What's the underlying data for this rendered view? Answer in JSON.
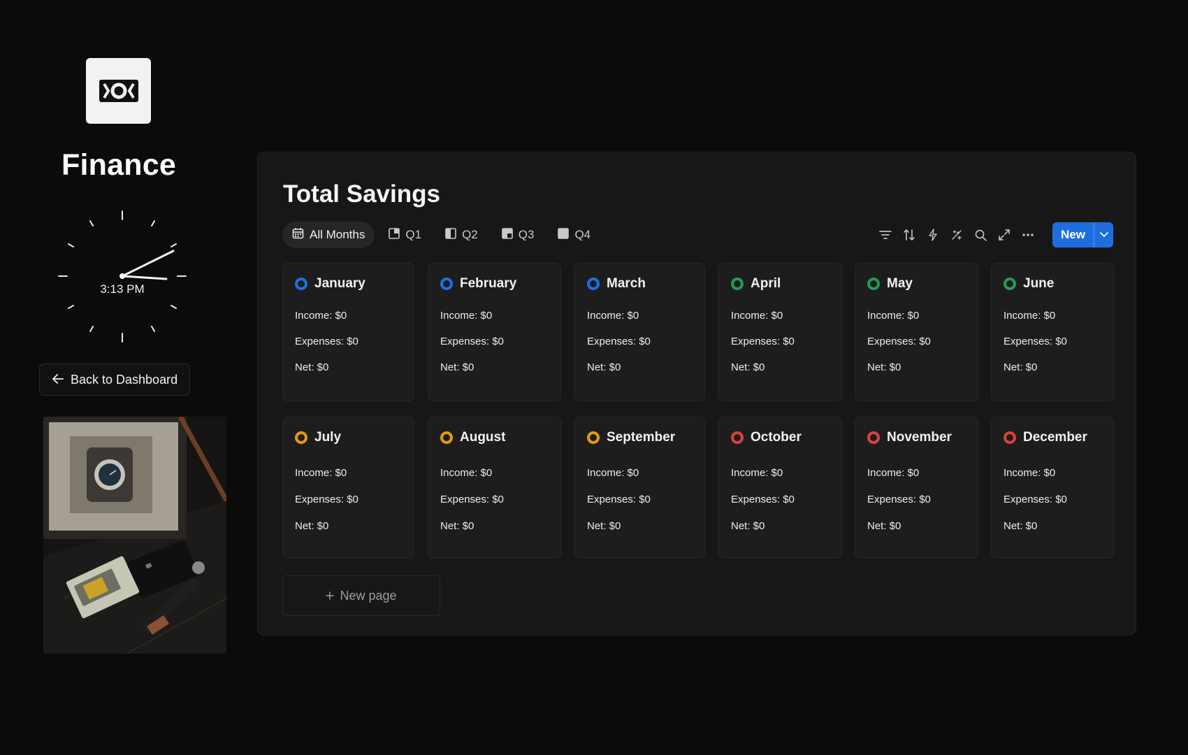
{
  "app": {
    "title": "Finance"
  },
  "clock": {
    "time": "3:13 PM"
  },
  "sidebar": {
    "back_label": "Back to Dashboard"
  },
  "panel": {
    "title": "Total Savings",
    "tabs": [
      {
        "label": "All Months",
        "icon": "calendar-icon",
        "active": true
      },
      {
        "label": "Q1",
        "icon": "quarter-icon",
        "active": false
      },
      {
        "label": "Q2",
        "icon": "quarter-icon",
        "active": false
      },
      {
        "label": "Q3",
        "icon": "quarter-icon",
        "active": false
      },
      {
        "label": "Q4",
        "icon": "quarter-icon",
        "active": false
      }
    ],
    "tools": [
      "filter-icon",
      "sort-icon",
      "automation-icon",
      "ai-icon",
      "search-icon",
      "expand-icon",
      "more-icon"
    ],
    "new_label": "New",
    "new_page_label": "New page"
  },
  "colors": {
    "blue": "#1e6fe6",
    "green": "#1f9d55",
    "orange": "#e09a12",
    "red": "#d9433b",
    "accent": "#1d6fe0"
  },
  "months": [
    {
      "name": "January",
      "status": "blue",
      "income": "Income: $0",
      "expenses": "Expenses: $0",
      "net": "Net: $0"
    },
    {
      "name": "February",
      "status": "blue",
      "income": "Income: $0",
      "expenses": "Expenses: $0",
      "net": "Net: $0"
    },
    {
      "name": "March",
      "status": "blue",
      "income": "Income: $0",
      "expenses": "Expenses: $0",
      "net": "Net: $0"
    },
    {
      "name": "April",
      "status": "green",
      "income": "Income: $0",
      "expenses": "Expenses: $0",
      "net": "Net: $0"
    },
    {
      "name": "May",
      "status": "green",
      "income": "Income: $0",
      "expenses": "Expenses: $0",
      "net": "Net: $0"
    },
    {
      "name": "June",
      "status": "green",
      "income": "Income: $0",
      "expenses": "Expenses: $0",
      "net": "Net: $0"
    },
    {
      "name": "July",
      "status": "orange",
      "income": "Income: $0",
      "expenses": "Expenses: $0",
      "net": "Net: $0"
    },
    {
      "name": "August",
      "status": "orange",
      "income": "Income: $0",
      "expenses": "Expenses: $0",
      "net": "Net: $0"
    },
    {
      "name": "September",
      "status": "orange",
      "income": "Income: $0",
      "expenses": "Expenses: $0",
      "net": "Net: $0"
    },
    {
      "name": "October",
      "status": "red",
      "income": "Income: $0",
      "expenses": "Expenses: $0",
      "net": "Net: $0"
    },
    {
      "name": "November",
      "status": "red",
      "income": "Income: $0",
      "expenses": "Expenses: $0",
      "net": "Net: $0"
    },
    {
      "name": "December",
      "status": "red",
      "income": "Income: $0",
      "expenses": "Expenses: $0",
      "net": "Net: $0"
    }
  ]
}
